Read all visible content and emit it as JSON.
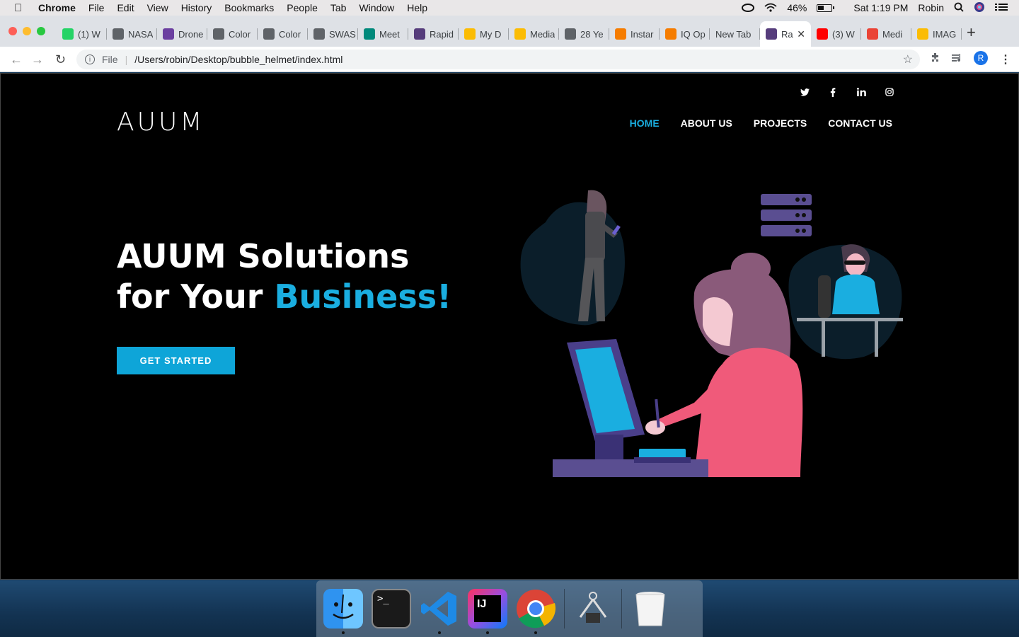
{
  "menubar": {
    "app_name": "Chrome",
    "items": [
      "File",
      "Edit",
      "View",
      "History",
      "Bookmarks",
      "People",
      "Tab",
      "Window",
      "Help"
    ],
    "battery_percent": "46%",
    "clock": "Sat 1:19 PM",
    "user": "Robin"
  },
  "tabs": [
    {
      "label": "(1) W",
      "icon": "whatsapp-icon",
      "color": "#25d366"
    },
    {
      "label": "NASA",
      "icon": "globe-icon",
      "color": "#5f6368"
    },
    {
      "label": "Drone",
      "icon": "site-icon",
      "color": "#6b3fa0"
    },
    {
      "label": "Color",
      "icon": "wordpress-icon",
      "color": "#5f6368"
    },
    {
      "label": "Color",
      "icon": "wordpress-icon",
      "color": "#5f6368"
    },
    {
      "label": "SWAS",
      "icon": "globe-icon",
      "color": "#5f6368"
    },
    {
      "label": "Meet",
      "icon": "meet-icon",
      "color": "#00897b"
    },
    {
      "label": "Rapid",
      "icon": "bootstrap-icon",
      "color": "#563d7c"
    },
    {
      "label": "My D",
      "icon": "drive-icon",
      "color": "#fbbc04"
    },
    {
      "label": "Media",
      "icon": "drive-icon",
      "color": "#fbbc04"
    },
    {
      "label": "28 Ye",
      "icon": "globe-icon",
      "color": "#5f6368"
    },
    {
      "label": "Instar",
      "icon": "analytics-icon",
      "color": "#f57c00"
    },
    {
      "label": "IQ Op",
      "icon": "analytics-icon",
      "color": "#f57c00"
    },
    {
      "label": "New Tab",
      "icon": "",
      "color": ""
    },
    {
      "label": "Ra",
      "icon": "bootstrap-icon",
      "color": "#563d7c",
      "active": true
    },
    {
      "label": "(3) W",
      "icon": "youtube-icon",
      "color": "#ff0000"
    },
    {
      "label": "Medi",
      "icon": "gmail-icon",
      "color": "#ea4335"
    },
    {
      "label": "IMAG",
      "icon": "drive-icon",
      "color": "#fbbc04"
    }
  ],
  "address": {
    "scheme": "File",
    "path": "/Users/robin/Desktop/bubble_helmet/index.html",
    "profile_initial": "R"
  },
  "page": {
    "logo": "AUUM",
    "social": [
      "twitter-icon",
      "facebook-icon",
      "linkedin-icon",
      "instagram-icon"
    ],
    "nav": [
      {
        "label": "HOME",
        "active": true
      },
      {
        "label": "ABOUT US",
        "active": false
      },
      {
        "label": "PROJECTS",
        "active": false
      },
      {
        "label": "CONTACT US",
        "active": false
      }
    ],
    "hero": {
      "line1": "AUUM Solutions",
      "line2_prefix": "for Your ",
      "line2_accent": "Business!"
    },
    "cta": "GET STARTED",
    "accent_color": "#1aaee0"
  },
  "dock": [
    "finder-icon",
    "terminal-icon",
    "vscode-icon",
    "intellij-icon",
    "chrome-icon",
    "system-info-icon",
    "trash-icon"
  ]
}
